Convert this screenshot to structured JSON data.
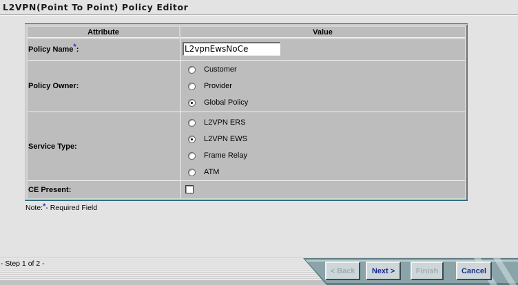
{
  "page": {
    "title": "L2VPN(Point To Point) Policy Editor"
  },
  "table": {
    "headers": {
      "attribute": "Attribute",
      "value": "Value"
    },
    "policy_name": {
      "label": "Policy Name",
      "required_mark": "*",
      "colon": ":",
      "value": "L2vpnEwsNoCe"
    },
    "policy_owner": {
      "label": "Policy Owner:",
      "options": [
        {
          "label": "Customer",
          "selected": false
        },
        {
          "label": "Provider",
          "selected": false
        },
        {
          "label": "Global Policy",
          "selected": true
        }
      ]
    },
    "service_type": {
      "label": "Service Type:",
      "options": [
        {
          "label": "L2VPN ERS",
          "selected": false
        },
        {
          "label": "L2VPN EWS",
          "selected": true
        },
        {
          "label": "Frame Relay",
          "selected": false
        },
        {
          "label": "ATM",
          "selected": false
        }
      ]
    },
    "ce_present": {
      "label": "CE Present:",
      "checked": false
    }
  },
  "note": {
    "prefix": "Note:",
    "mark": "*",
    "suffix": "- Required Field"
  },
  "footer": {
    "step": "- Step 1 of 2 -",
    "buttons": {
      "back": "< Back",
      "next": "Next >",
      "finish": "Finish",
      "cancel": "Cancel"
    }
  },
  "colors": {
    "accent": "#1b6f82",
    "button_enabled_text": "#1a2b8c",
    "required_mark": "#1a2fd6"
  }
}
